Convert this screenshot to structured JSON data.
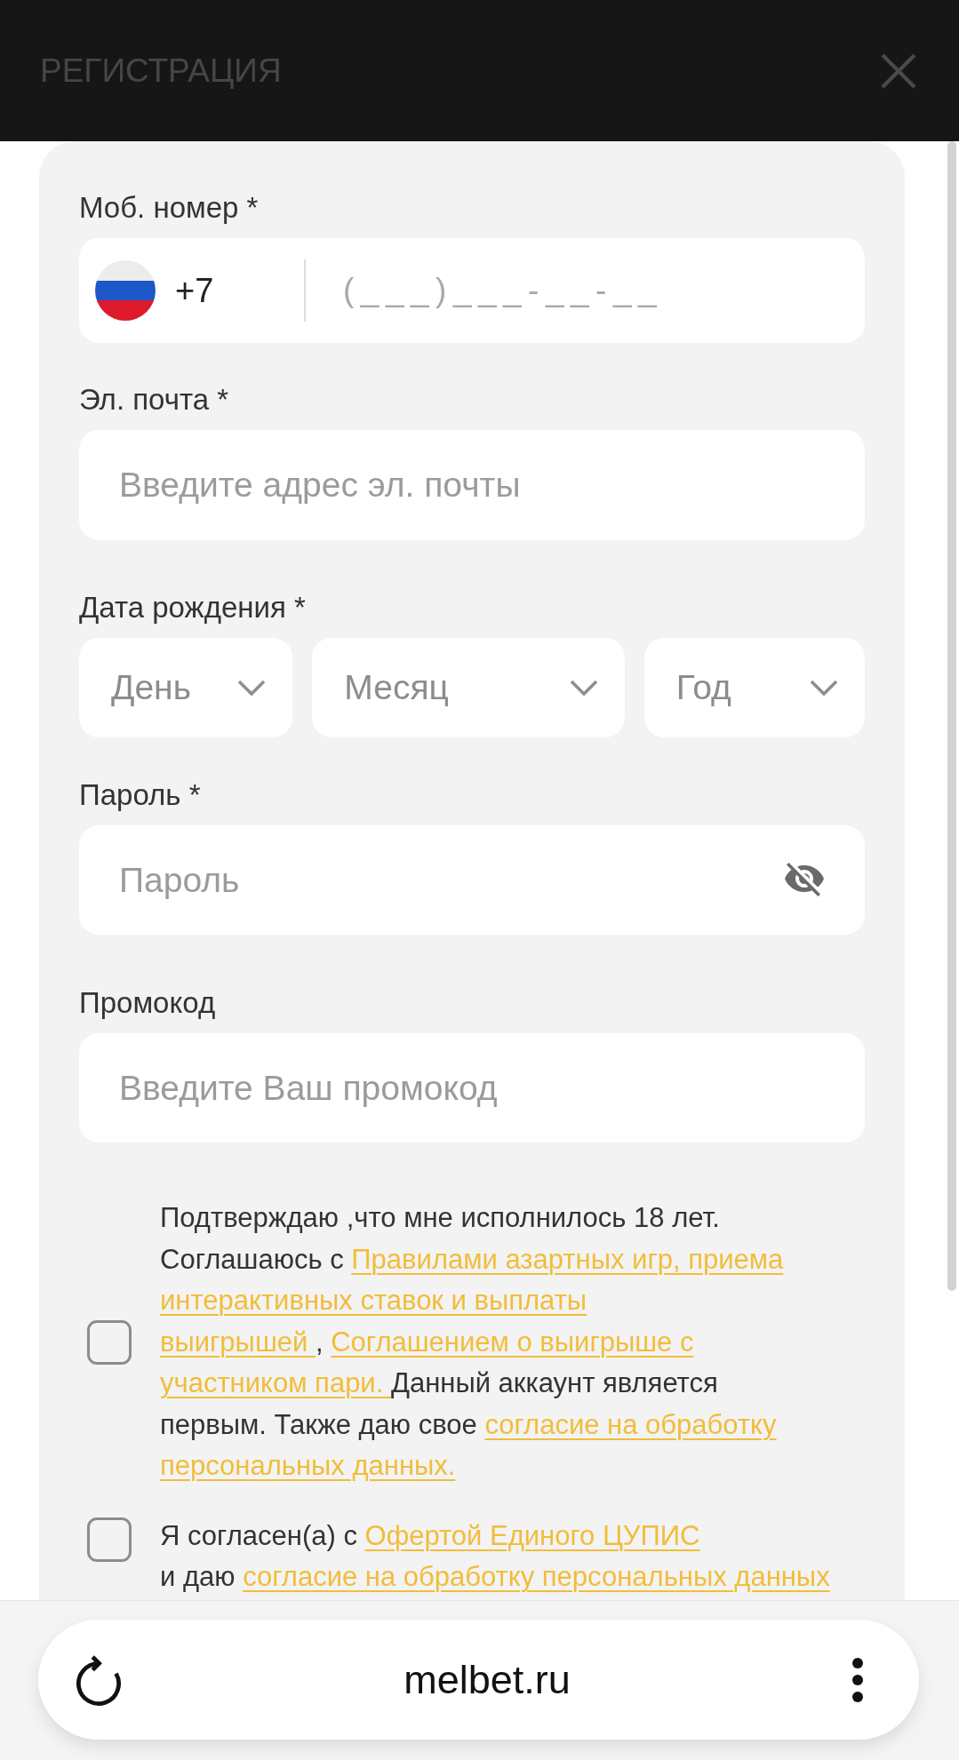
{
  "header": {
    "title": "РЕГИСТРАЦИЯ"
  },
  "form": {
    "phone": {
      "label": "Моб. номер *",
      "country_code": "+7",
      "placeholder": "(___)___-__-__"
    },
    "email": {
      "label": "Эл. почта *",
      "placeholder": "Введите адрес эл. почты"
    },
    "birth_date": {
      "label": "Дата рождения *",
      "selects": [
        {
          "placeholder": "День"
        },
        {
          "placeholder": "Месяц"
        },
        {
          "placeholder": "Год"
        }
      ]
    },
    "password": {
      "label": "Пароль *",
      "placeholder": "Пароль"
    },
    "promo_code": {
      "label": "Промокод",
      "placeholder": "Введите Ваш промокод"
    },
    "consents": [
      {
        "checked": false,
        "lines": [
          [
            {
              "kind": "text",
              "text": "Подтверждаю ,что мне исполнилось 18 лет."
            }
          ],
          [
            {
              "kind": "text",
              "text": "Соглашаюсь с "
            },
            {
              "kind": "link",
              "text": "Правилами азартных игр, приема"
            }
          ],
          [
            {
              "kind": "link",
              "text": "интерактивных ставок и выплаты"
            }
          ],
          [
            {
              "kind": "link",
              "text": "выигрышей "
            },
            {
              "kind": "text",
              "text": ", "
            },
            {
              "kind": "link",
              "text": "Соглашением о выигрыше с"
            }
          ],
          [
            {
              "kind": "link",
              "text": "участником пари. "
            },
            {
              "kind": "text",
              "text": "Данный аккаунт является"
            }
          ],
          [
            {
              "kind": "text",
              "text": "первым. Также даю свое "
            },
            {
              "kind": "link",
              "text": "согласие на обработку"
            }
          ],
          [
            {
              "kind": "link",
              "text": "персональных данных."
            }
          ]
        ]
      },
      {
        "checked": false,
        "lines": [
          [
            {
              "kind": "text",
              "text": "Я согласен(а) с "
            },
            {
              "kind": "link",
              "text": "Офертой Единого ЦУПИС"
            }
          ],
          [
            {
              "kind": "text",
              "text": "и даю "
            },
            {
              "kind": "link",
              "text": "согласие на обработку персональных данных"
            }
          ]
        ]
      }
    ]
  },
  "browser_bar": {
    "url": "melbet.ru"
  }
}
